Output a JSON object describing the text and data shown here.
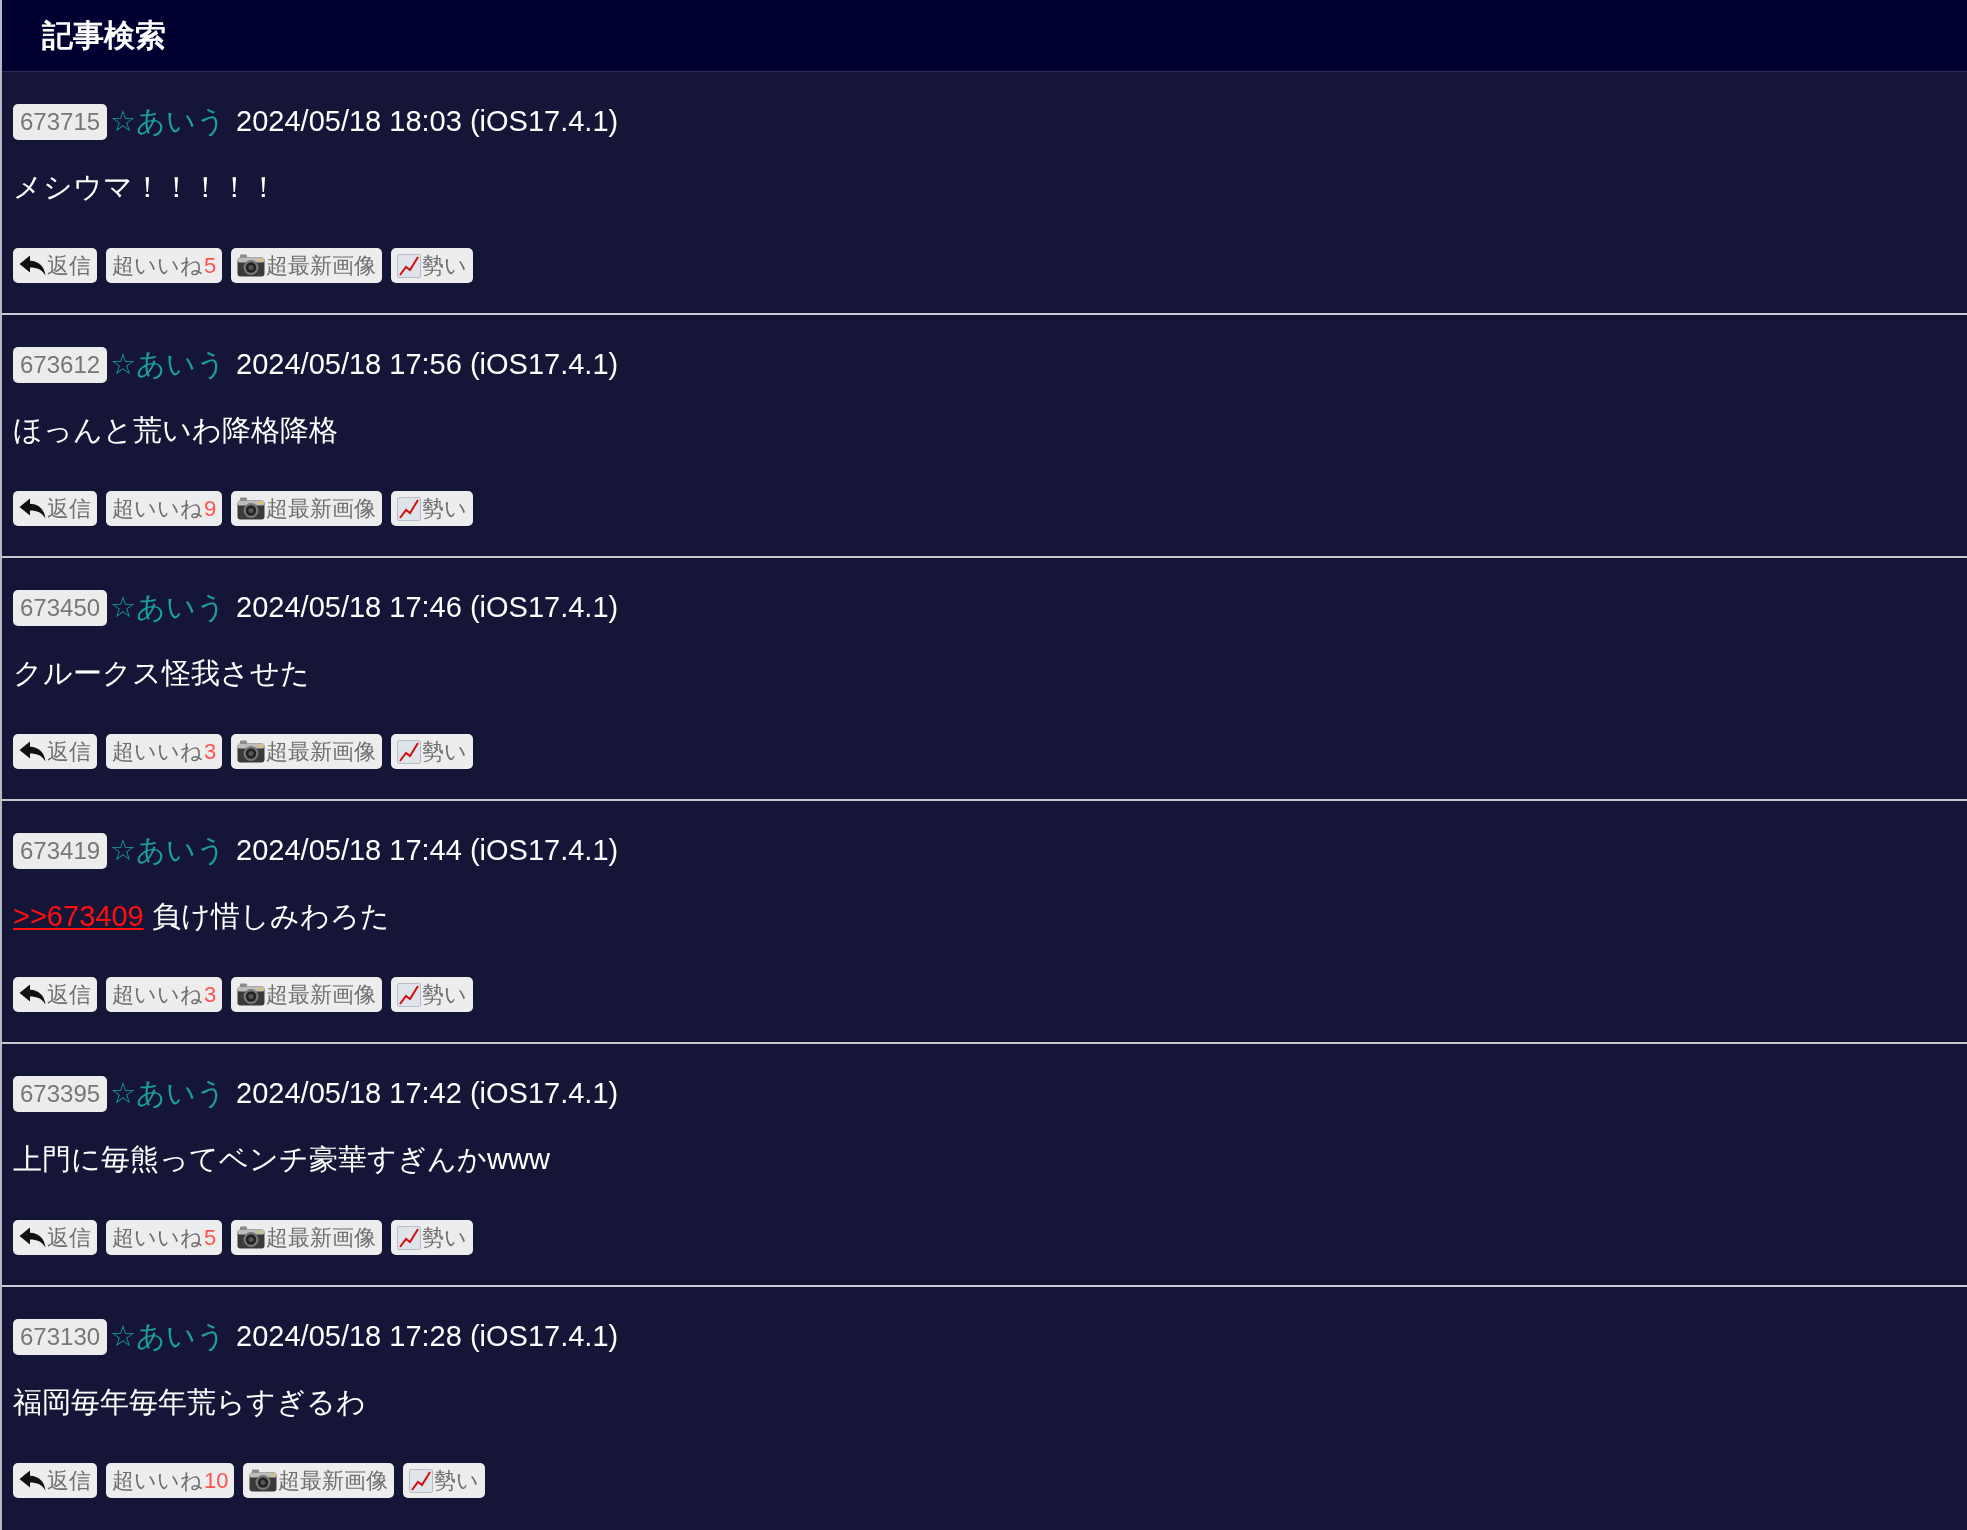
{
  "header": {
    "title": "記事検索"
  },
  "posts": [
    {
      "number": "673715",
      "name": "☆あいう",
      "date": "2024/05/18 18:03 (iOS17.4.1)",
      "body": [
        {
          "kind": "text",
          "text": "メシウマ！！！！！"
        }
      ],
      "buttons": [
        {
          "kind": "reply",
          "label": "返信"
        },
        {
          "kind": "like",
          "label": "超いいね",
          "count": "5"
        },
        {
          "kind": "images",
          "label": "超最新画像"
        },
        {
          "kind": "trend",
          "label": "勢い"
        }
      ]
    },
    {
      "number": "673612",
      "name": "☆あいう",
      "date": "2024/05/18 17:56 (iOS17.4.1)",
      "body": [
        {
          "kind": "text",
          "text": "ほっんと荒いわ降格降格"
        }
      ],
      "buttons": [
        {
          "kind": "reply",
          "label": "返信"
        },
        {
          "kind": "like",
          "label": "超いいね",
          "count": "9"
        },
        {
          "kind": "images",
          "label": "超最新画像"
        },
        {
          "kind": "trend",
          "label": "勢い"
        }
      ]
    },
    {
      "number": "673450",
      "name": "☆あいう",
      "date": "2024/05/18 17:46 (iOS17.4.1)",
      "body": [
        {
          "kind": "text",
          "text": "クルークス怪我させた"
        }
      ],
      "buttons": [
        {
          "kind": "reply",
          "label": "返信"
        },
        {
          "kind": "like",
          "label": "超いいね",
          "count": "3"
        },
        {
          "kind": "images",
          "label": "超最新画像"
        },
        {
          "kind": "trend",
          "label": "勢い"
        }
      ]
    },
    {
      "number": "673419",
      "name": "☆あいう",
      "date": "2024/05/18 17:44 (iOS17.4.1)",
      "body": [
        {
          "kind": "link",
          "text": ">>673409"
        },
        {
          "kind": "text",
          "text": " 負け惜しみわろた"
        }
      ],
      "buttons": [
        {
          "kind": "reply",
          "label": "返信"
        },
        {
          "kind": "like",
          "label": "超いいね",
          "count": "3"
        },
        {
          "kind": "images",
          "label": "超最新画像"
        },
        {
          "kind": "trend",
          "label": "勢い"
        }
      ]
    },
    {
      "number": "673395",
      "name": "☆あいう",
      "date": "2024/05/18 17:42 (iOS17.4.1)",
      "body": [
        {
          "kind": "text",
          "text": "上門に毎熊ってベンチ豪華すぎんかwww"
        }
      ],
      "buttons": [
        {
          "kind": "reply",
          "label": "返信"
        },
        {
          "kind": "like",
          "label": "超いいね",
          "count": "5"
        },
        {
          "kind": "images",
          "label": "超最新画像"
        },
        {
          "kind": "trend",
          "label": "勢い"
        }
      ]
    },
    {
      "number": "673130",
      "name": "☆あいう",
      "date": "2024/05/18 17:28 (iOS17.4.1)",
      "body": [
        {
          "kind": "text",
          "text": "福岡毎年毎年荒らすぎるわ"
        }
      ],
      "buttons": [
        {
          "kind": "reply",
          "label": "返信"
        },
        {
          "kind": "like",
          "label": "超いいね",
          "count": "10"
        },
        {
          "kind": "images",
          "label": "超最新画像"
        },
        {
          "kind": "trend",
          "label": "勢い"
        }
      ]
    }
  ]
}
